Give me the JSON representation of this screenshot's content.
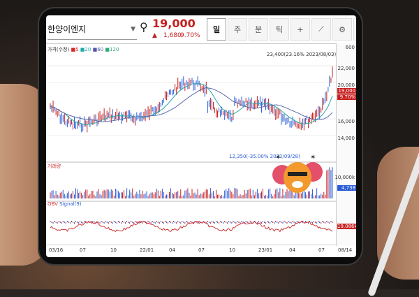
{
  "stock": {
    "name": "한양이엔지",
    "price": "19,000",
    "change_arrow": "▲",
    "change": "1,680",
    "change_pct": "9.70%"
  },
  "tabs": [
    {
      "label": "일",
      "active": true
    },
    {
      "label": "주",
      "active": false
    },
    {
      "label": "분",
      "active": false
    },
    {
      "label": "틱",
      "active": false
    }
  ],
  "toolbar_icons": [
    "crosshair-icon",
    "draw-icon",
    "gear-icon",
    "pen-icon"
  ],
  "legend": {
    "title": "가격(수정)",
    "ma5": "5",
    "ma20": "20",
    "ma60": "60",
    "ma120": "120"
  },
  "price_axis": {
    "top": "600",
    "l22000": "22,000",
    "l20000": "20,000",
    "l16000": "16,000",
    "l14000": "14,000",
    "current": "19,000",
    "current_pct": "9.70%"
  },
  "annotations": {
    "high": "23,400(23.16% 2023/08/03)",
    "low": "12,350(-35.00% 2022/09/28)"
  },
  "volume_panel": {
    "title": "거래량",
    "axis_label": "10,000k",
    "current": "4,738"
  },
  "obv_panel": {
    "title": "OBV",
    "signal": "Signal(9)",
    "current": "19,086k"
  },
  "x_axis": [
    "03/16",
    "07",
    "10",
    "22/01",
    "04",
    "07",
    "10",
    "23/01",
    "04",
    "07",
    "08/14"
  ],
  "colors": {
    "up": "#c71f1f",
    "down": "#2a5bd7",
    "ma20": "#2aa6a6",
    "ma60": "#5a6ab0"
  }
}
